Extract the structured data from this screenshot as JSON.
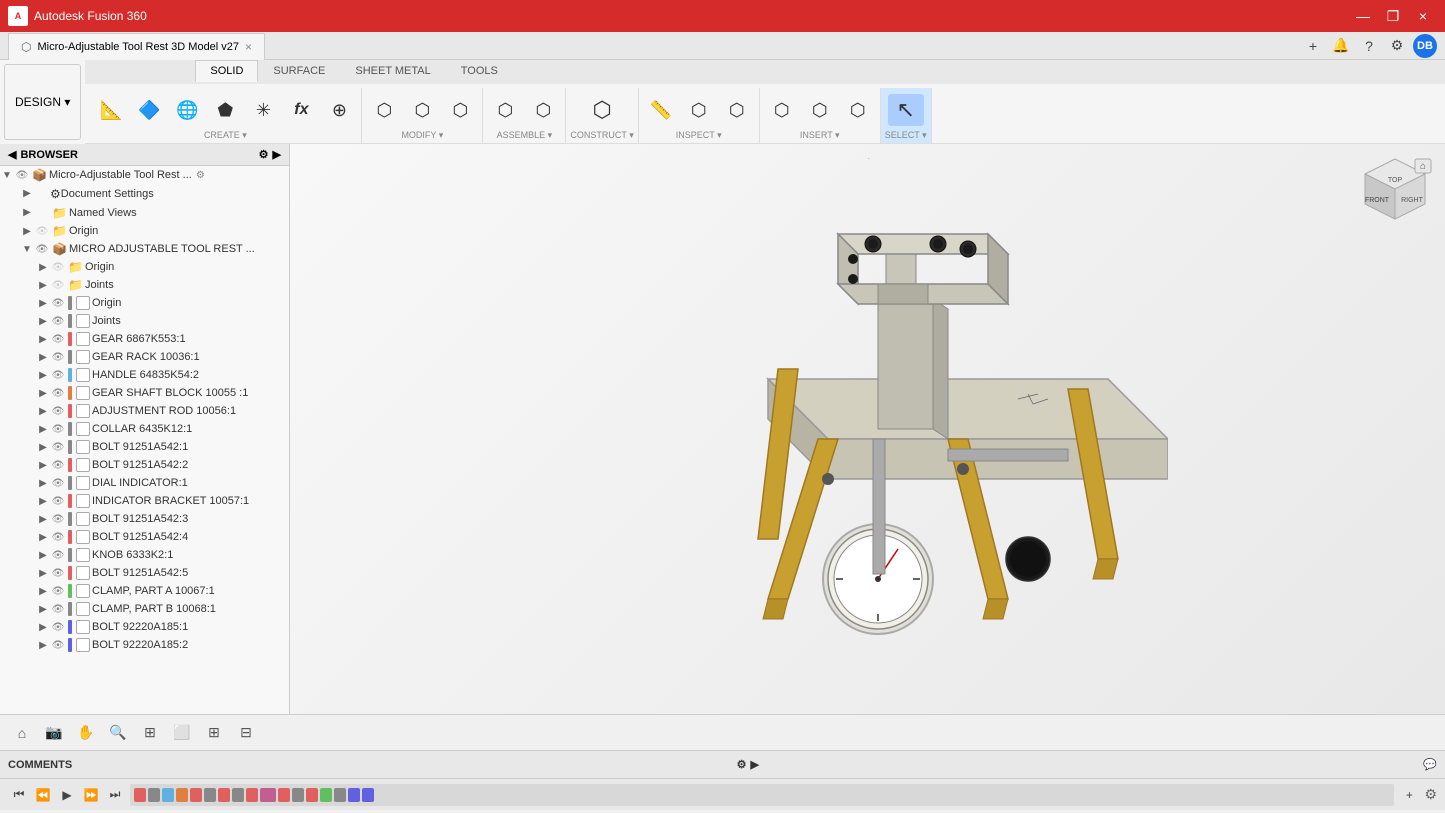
{
  "titlebar": {
    "app_name": "Autodesk Fusion 360",
    "close_btn": "×",
    "minimize_btn": "—",
    "maximize_btn": "❐"
  },
  "tab": {
    "icon": "⬡",
    "title": "Micro-Adjustable Tool Rest 3D Model v27",
    "close": "×"
  },
  "design_btn": "DESIGN ▾",
  "ribbon_tabs": [
    "SOLID",
    "SURFACE",
    "SHEET METAL",
    "TOOLS"
  ],
  "active_tab": "SOLID",
  "toolbar_sections": {
    "create": {
      "label": "CREATE ▾",
      "buttons": [
        "🔲",
        "🔷",
        "🌐",
        "⬟",
        "✳",
        "📐",
        "∫",
        "⊕"
      ]
    },
    "modify": {
      "label": "MODIFY ▾",
      "buttons": [
        "⬡",
        "⬡",
        "⬡"
      ]
    },
    "assemble": {
      "label": "ASSEMBLE ▾",
      "buttons": [
        "⬡",
        "⬡"
      ]
    },
    "construct": {
      "label": "CONSTRUCT ▾",
      "buttons": [
        "⬡"
      ]
    },
    "inspect": {
      "label": "INSPECT ▾",
      "buttons": [
        "📏",
        "⬡",
        "⬡"
      ]
    },
    "insert": {
      "label": "INSERT ▾",
      "buttons": [
        "⬡",
        "⬡",
        "⬡"
      ]
    },
    "select": {
      "label": "SELECT ▾",
      "buttons": [
        "↖"
      ]
    }
  },
  "browser": {
    "header": "BROWSER",
    "root": {
      "label": "Micro-Adjustable Tool Rest ...",
      "children": [
        {
          "label": "Document Settings",
          "icon": "⚙",
          "indent": 1
        },
        {
          "label": "Named Views",
          "icon": "📁",
          "indent": 1
        },
        {
          "label": "Origin",
          "icon": "📁",
          "indent": 1
        },
        {
          "label": "MICRO ADJUSTABLE TOOL REST ...",
          "icon": "📦",
          "indent": 1,
          "children": [
            {
              "label": "Origin",
              "icon": "📁",
              "indent": 2
            },
            {
              "label": "Joints",
              "icon": "📁",
              "indent": 2
            },
            {
              "label": "GEAR 6867K553:1",
              "color": "#e06060",
              "indent": 2
            },
            {
              "label": "GEAR RACK 10036:1",
              "color": "#888888",
              "indent": 2
            },
            {
              "label": "HANDLE 64835K54:2",
              "color": "#60b0e0",
              "indent": 2
            },
            {
              "label": "GEAR SHAFT BLOCK 10055 :1",
              "color": "#e08040",
              "indent": 2
            },
            {
              "label": "ADJUSTMENT ROD 10056:1",
              "color": "#e06060",
              "indent": 2
            },
            {
              "label": "COLLAR 6435K12:1",
              "color": "#888888",
              "indent": 2
            },
            {
              "label": "BOLT 91251A542:1",
              "color": "#888888",
              "indent": 2
            },
            {
              "label": "BOLT 91251A542:2",
              "color": "#e06060",
              "indent": 2
            },
            {
              "label": "DIAL INDICATOR:1",
              "color": "#888888",
              "indent": 2
            },
            {
              "label": "INDICATOR BRACKET 10057:1",
              "color": "#e06060",
              "indent": 2
            },
            {
              "label": "BOLT 91251A542:3",
              "color": "#888888",
              "indent": 2
            },
            {
              "label": "BOLT 91251A542:4",
              "color": "#e06060",
              "indent": 2
            },
            {
              "label": "KNOB 6333K2:1",
              "color": "#888888",
              "indent": 2
            },
            {
              "label": "BOLT 91251A542:5",
              "color": "#e06060",
              "indent": 2
            },
            {
              "label": "CLAMP, PART A 10067:1",
              "color": "#60c060",
              "indent": 2
            },
            {
              "label": "CLAMP, PART B 10068:1",
              "color": "#888888",
              "indent": 2
            },
            {
              "label": "BOLT 92220A185:1",
              "color": "#6060e0",
              "indent": 2
            },
            {
              "label": "BOLT 92220A185:2",
              "color": "#6060e0",
              "indent": 2
            }
          ]
        }
      ]
    }
  },
  "bottom_toolbar": {
    "buttons": [
      "🏠",
      "📷",
      "✋",
      "🔍",
      "🔎",
      "⬜",
      "⊞",
      "⊟"
    ]
  },
  "timeline": {
    "controls": [
      "⏮",
      "⏪",
      "▶",
      "⏩",
      "⏭"
    ],
    "add_btn": "+"
  },
  "comments": {
    "label": "COMMENTS",
    "chat_icon": "💬"
  },
  "viewcube": {
    "label": "FRONT"
  },
  "viewport_dot": "·"
}
